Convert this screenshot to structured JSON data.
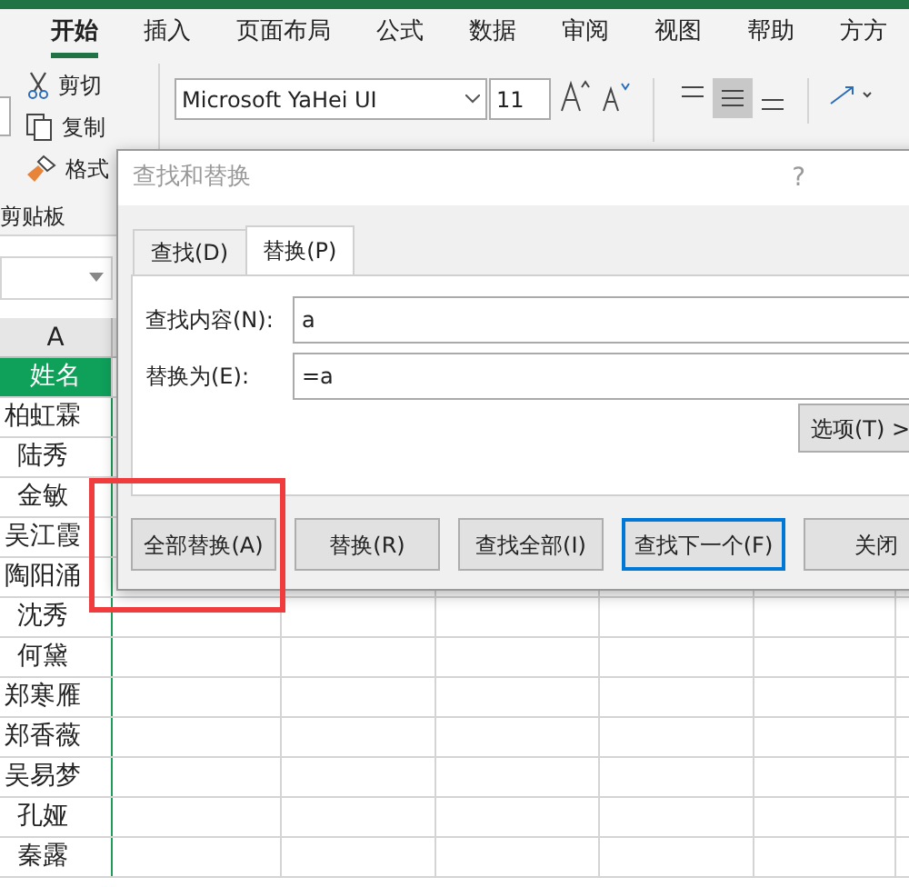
{
  "ribbon_tabs": [
    {
      "label": "开始",
      "selected": true
    },
    {
      "label": "插入",
      "selected": false
    },
    {
      "label": "页面布局",
      "selected": false
    },
    {
      "label": "公式",
      "selected": false
    },
    {
      "label": "数据",
      "selected": false
    },
    {
      "label": "审阅",
      "selected": false
    },
    {
      "label": "视图",
      "selected": false
    },
    {
      "label": "帮助",
      "selected": false
    },
    {
      "label": "方方",
      "selected": false
    }
  ],
  "clipboard": {
    "cut": "剪切",
    "copy": "复制",
    "format_painter": "格式",
    "group_label": "剪贴板"
  },
  "font": {
    "family": "Microsoft YaHei UI",
    "size": "11"
  },
  "sheet": {
    "column_header": "A",
    "header_cell": "姓名",
    "names": [
      "柏虹霖",
      "陆秀",
      "金敏",
      "吴江霞",
      "陶阳涌",
      "沈秀",
      "何黛",
      "郑寒雁",
      "郑香薇",
      "吴易梦",
      "孔娅",
      "秦露"
    ]
  },
  "dialog": {
    "title": "查找和替换",
    "help": "?",
    "tabs": [
      {
        "label": "查找(D)",
        "selected": false
      },
      {
        "label": "替换(P)",
        "selected": true
      }
    ],
    "fields": [
      {
        "label": "查找内容(N):",
        "value": "a"
      },
      {
        "label": "替换为(E):",
        "value": "=a"
      }
    ],
    "options_button": "选项(T) >",
    "buttons": [
      {
        "label": "全部替换(A)",
        "default": false,
        "highlighted": true
      },
      {
        "label": "替换(R)",
        "default": false,
        "highlighted": false
      },
      {
        "label": "查找全部(I)",
        "default": false,
        "highlighted": false
      },
      {
        "label": "查找下一个(F)",
        "default": true,
        "highlighted": false
      },
      {
        "label": "关闭",
        "default": false,
        "highlighted": false
      }
    ]
  }
}
